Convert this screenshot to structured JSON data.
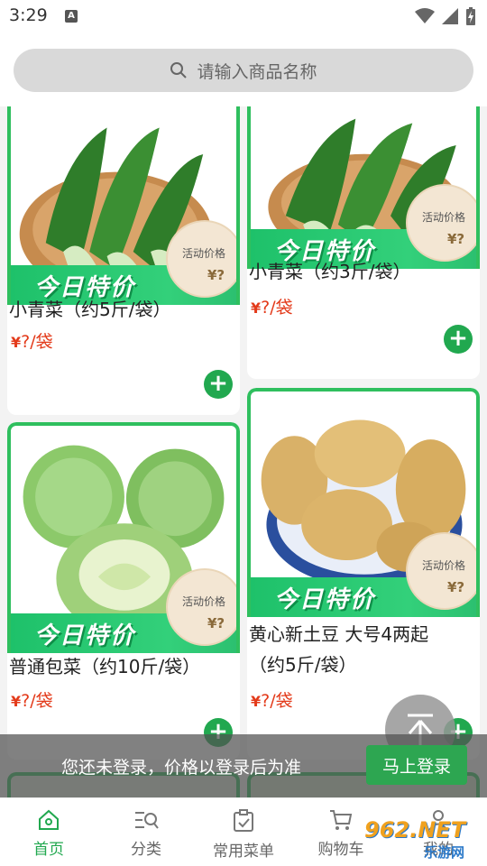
{
  "status": {
    "time": "3:29",
    "a_icon": "A"
  },
  "search": {
    "placeholder": "请输入商品名称"
  },
  "products": [
    {
      "name": "小青菜（约5斤/袋）",
      "price_symbol": "¥",
      "price_value": "?",
      "price_unit": "/袋",
      "promo": "今日特价",
      "badge_label": "活动价格",
      "badge_price": "¥?",
      "image": "bok-choy"
    },
    {
      "name": "小青菜（约3斤/袋）",
      "price_symbol": "¥",
      "price_value": "?",
      "price_unit": "/袋",
      "promo": "今日特价",
      "badge_label": "活动价格",
      "badge_price": "¥?",
      "image": "bok-choy"
    },
    {
      "name": "普通包菜（约10斤/袋）",
      "price_symbol": "¥",
      "price_value": "?",
      "price_unit": "/袋",
      "promo": "今日特价",
      "badge_label": "活动价格",
      "badge_price": "¥?",
      "image": "cabbage"
    },
    {
      "name": "黄心新土豆 大号4两起",
      "name_line2": "（约5斤/袋）",
      "price_symbol": "¥",
      "price_value": "?",
      "price_unit": "/袋",
      "promo": "今日特价",
      "badge_label": "活动价格",
      "badge_price": "¥?",
      "image": "potato"
    }
  ],
  "login_prompt": {
    "message": "您还未登录，价格以登录后为准",
    "button": "马上登录"
  },
  "nav": [
    {
      "label": "首页",
      "icon": "home-icon",
      "active": true
    },
    {
      "label": "分类",
      "icon": "category-search-icon",
      "active": false
    },
    {
      "label": "常用菜单",
      "icon": "clipboard-check-icon",
      "active": false
    },
    {
      "label": "购物车",
      "icon": "cart-icon",
      "active": false
    },
    {
      "label": "我的",
      "icon": "person-icon",
      "active": false
    }
  ],
  "watermark": {
    "text": "962.NET",
    "subtext": "乐游网"
  },
  "colors": {
    "accent": "#21a84f",
    "price": "#e33a1a",
    "promo_green": "#2fbf5e"
  }
}
